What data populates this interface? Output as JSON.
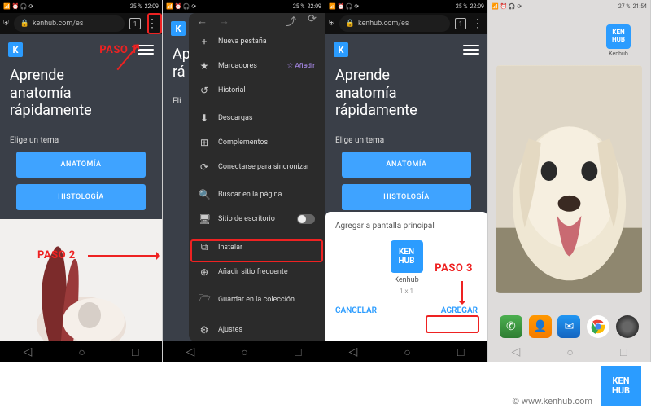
{
  "status": {
    "left_icons": "📶 ⏰ 🎧 ⟳",
    "battery": "25 %",
    "time1": "22:09",
    "time4": "21:54"
  },
  "browser": {
    "url": "kenhub.com/es",
    "tab_count": "1"
  },
  "page": {
    "logo": "K",
    "headline": "Aprende anatomía rápidamente",
    "subhead": "Elige un tema",
    "btn_anatomy": "ANATOMÍA",
    "btn_histology": "HISTOLOGÍA"
  },
  "steps": {
    "paso1": "PASO 1",
    "paso2": "PASO 2",
    "paso3": "PASO 3"
  },
  "ffmenu": {
    "items": [
      {
        "icon": "+",
        "label": "Nueva pestaña"
      },
      {
        "icon": "★",
        "label": "Marcadores",
        "extra": "☆ Añadir"
      },
      {
        "icon": "↺",
        "label": "Historial"
      },
      {
        "icon": "⬇",
        "label": "Descargas"
      },
      {
        "icon": "⊞",
        "label": "Complementos"
      },
      {
        "icon": "⟳",
        "label": "Conectarse para sincronizar"
      },
      {
        "icon": "🔍",
        "label": "Buscar en la página"
      },
      {
        "icon": "🖥",
        "label": "Sitio de escritorio",
        "toggle": true
      },
      {
        "icon": "⧉",
        "label": "Instalar",
        "highlight": true
      },
      {
        "icon": "⊕",
        "label": "Añadir sitio frecuente"
      },
      {
        "icon": "🗁",
        "label": "Guardar en la colección"
      },
      {
        "icon": "⚙",
        "label": "Ajustes"
      }
    ]
  },
  "dialog": {
    "title": "Agregar a pantalla principal",
    "icon_text": "KEN\nHUB",
    "name": "Kenhub",
    "dim": "1 x 1",
    "cancel": "CANCELAR",
    "add": "AGREGAR"
  },
  "home": {
    "app_label": "Kenhub"
  },
  "footer": {
    "copyright": "© www.kenhub.com",
    "logo_text": "KEN\nHUB"
  },
  "nav": {
    "back": "◁",
    "home": "○",
    "recent": "□"
  }
}
